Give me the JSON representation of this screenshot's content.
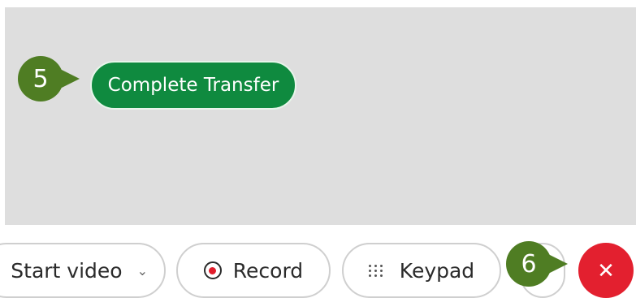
{
  "callouts": {
    "step5": "5",
    "step6": "6"
  },
  "transfer": {
    "complete_label": "Complete Transfer"
  },
  "toolbar": {
    "start_video_label": "Start video",
    "start_video_chevron": "⌄",
    "record_label": "Record",
    "keypad_label": "Keypad",
    "end_call_glyph": "✕"
  },
  "colors": {
    "panel_bg": "#dedede",
    "callout_green": "#4f7d23",
    "transfer_green": "#0f8a3f",
    "end_call_red": "#e3202f",
    "record_red": "#e11d2b"
  },
  "icons": {
    "record": "record-icon",
    "keypad": "keypad-icon",
    "end_call": "close-icon",
    "dropdown": "chevron-down-icon"
  }
}
